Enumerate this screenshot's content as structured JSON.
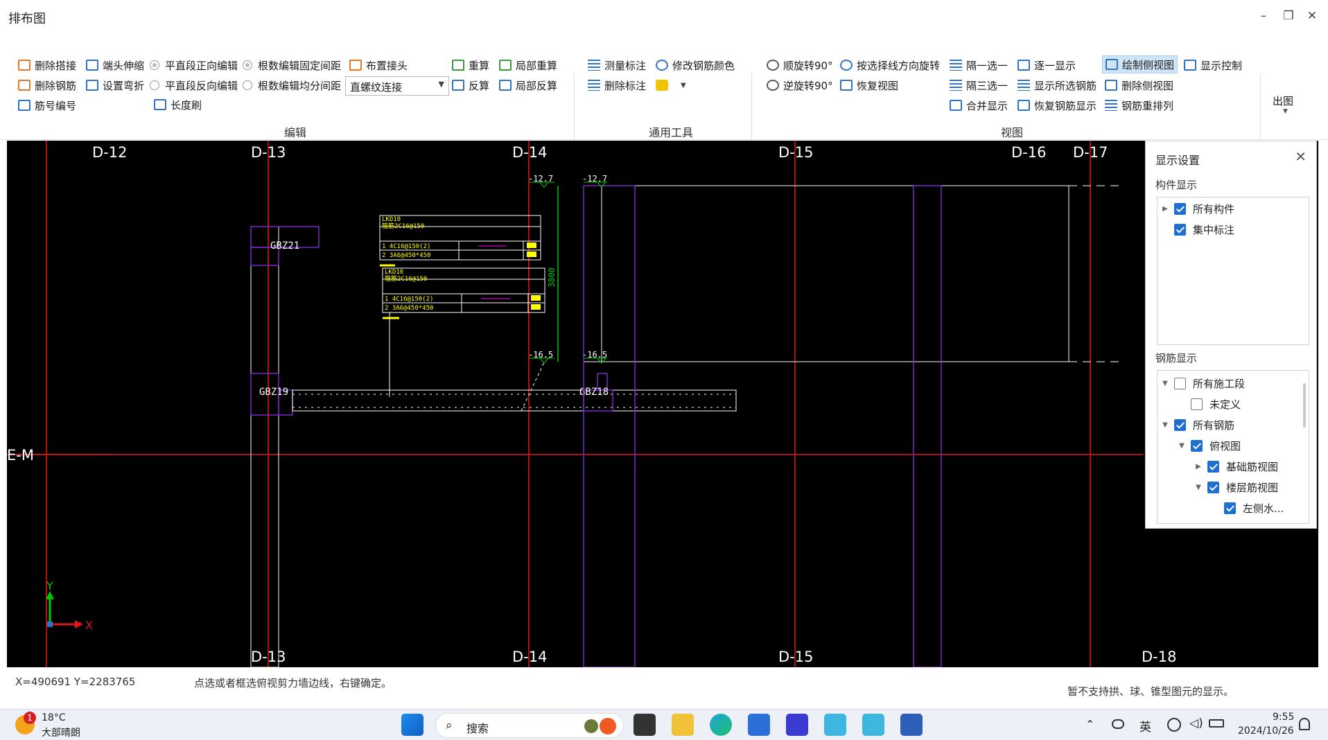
{
  "window": {
    "title": "排布图",
    "minimize": "–",
    "restore": "❐",
    "close": "✕"
  },
  "ribbon": {
    "edit": {
      "group_label": "编辑",
      "delete_lap": "删除搭接",
      "end_extend": "端头伸缩",
      "delete_rebar": "删除钢筋",
      "set_odd_fold": "设置弯折",
      "rebar_number": "筋号编号",
      "straight_forward": "平直段正向编辑",
      "straight_reverse": "平直段反向编辑",
      "length_brush": "长度刷",
      "count_fixed": "根数编辑固定间距",
      "count_even": "根数编辑均分间距",
      "arrange_joint": "布置接头",
      "joint_type": "直螺纹连接",
      "recalc": "重算",
      "local_recalc": "局部重算",
      "reverse_calc": "反算",
      "local_reverse": "局部反算"
    },
    "tools": {
      "group_label": "通用工具",
      "measure_mark": "测量标注",
      "modify_color": "修改钢筋颜色",
      "delete_mark": "删除标注"
    },
    "view": {
      "group_label": "视图",
      "rotate_cw": "顺旋转90°",
      "rotate_by_line": "按选择线方向旋转",
      "pick_one_interval": "隔一选一",
      "show_one_by_one": "逐一显示",
      "draw_side_view": "绘制侧视图",
      "display_control": "显示控制",
      "rotate_ccw": "逆旋转90°",
      "restore_view": "恢复视图",
      "pick_three_interval": "隔三选一",
      "show_selected": "显示所选钢筋",
      "delete_side_view": "删除侧视图",
      "merge_display": "合并显示",
      "restore_rebar_display": "恢复钢筋显示",
      "rebar_rearrange": "钢筋重排列"
    },
    "output": {
      "label": "出图"
    }
  },
  "canvas": {
    "axes_top": [
      "D-12",
      "D-13",
      "D-14",
      "D-15",
      "D-16",
      "D-17"
    ],
    "axes_bottom": [
      "D-13",
      "D-14",
      "D-15",
      "D-18"
    ],
    "axis_left": "E-M",
    "members": [
      "GBZ21",
      "GBZ19",
      "GBZ18"
    ],
    "elevations": [
      "-12.7",
      "-12.7",
      "-16.5",
      "-16.5"
    ],
    "dimension": "3800",
    "table1": {
      "title": "LKD10",
      "header": "箍筋2C16@150",
      "row1": "1  4C16@150(2)",
      "row2": "2  3A6@450*450"
    },
    "table2": {
      "title": "LKD10",
      "header": "箍筋2C16@150",
      "row1": "1  4C16@150(2)",
      "row2": "2  3A6@450*450"
    },
    "coord_x": "X",
    "coord_y": "Y"
  },
  "panel": {
    "title": "显示设置",
    "close": "✕",
    "component_section": "构件显示",
    "all_components": "所有构件",
    "centralized_mark": "集中标注",
    "rebar_section": "钢筋显示",
    "all_construction": "所有施工段",
    "undefined": "未定义",
    "all_rebar": "所有钢筋",
    "top_view": "俯视图",
    "foundation_view": "基础筋视图",
    "floor_view": "楼层筋视图",
    "left_water": "左侧水..."
  },
  "status": {
    "coords": "X=490691 Y=2283765",
    "hint": "点选或者框选俯视剪力墙边线，右键确定。",
    "note": "暂不支持拱、球、锥型图元的显示。"
  },
  "taskbar": {
    "weather_temp": "18°C",
    "weather_desc": "大部晴朗",
    "weather_badge": "1",
    "search": "搜索",
    "lang": "英",
    "time": "9:55",
    "date": "2024/10/26"
  },
  "colors": {
    "canvas_bg": "#000000",
    "axis_red": "#e01818",
    "member_purple": "#7a28c8",
    "annotation_yellow": "#ffff00",
    "dim_green": "#00c800",
    "accent_blue": "#1f6fd1"
  }
}
